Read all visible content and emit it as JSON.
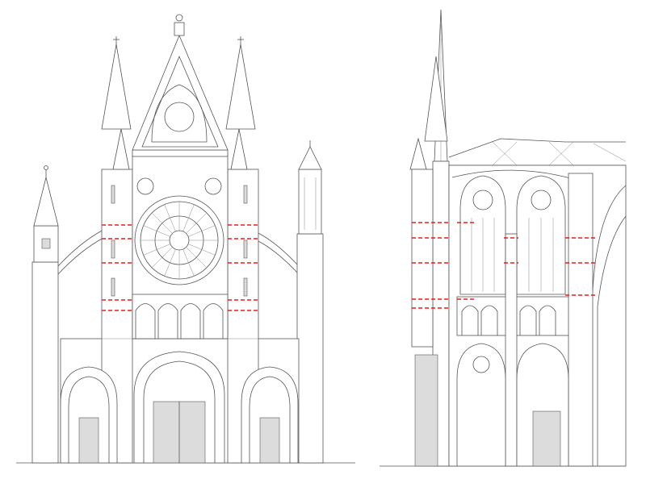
{
  "drawing": {
    "views": [
      {
        "name": "west-facade-elevation"
      },
      {
        "name": "longitudinal-section"
      }
    ],
    "marker_color": "#dd2020",
    "line_color": "#555555",
    "background": "#ffffff"
  }
}
